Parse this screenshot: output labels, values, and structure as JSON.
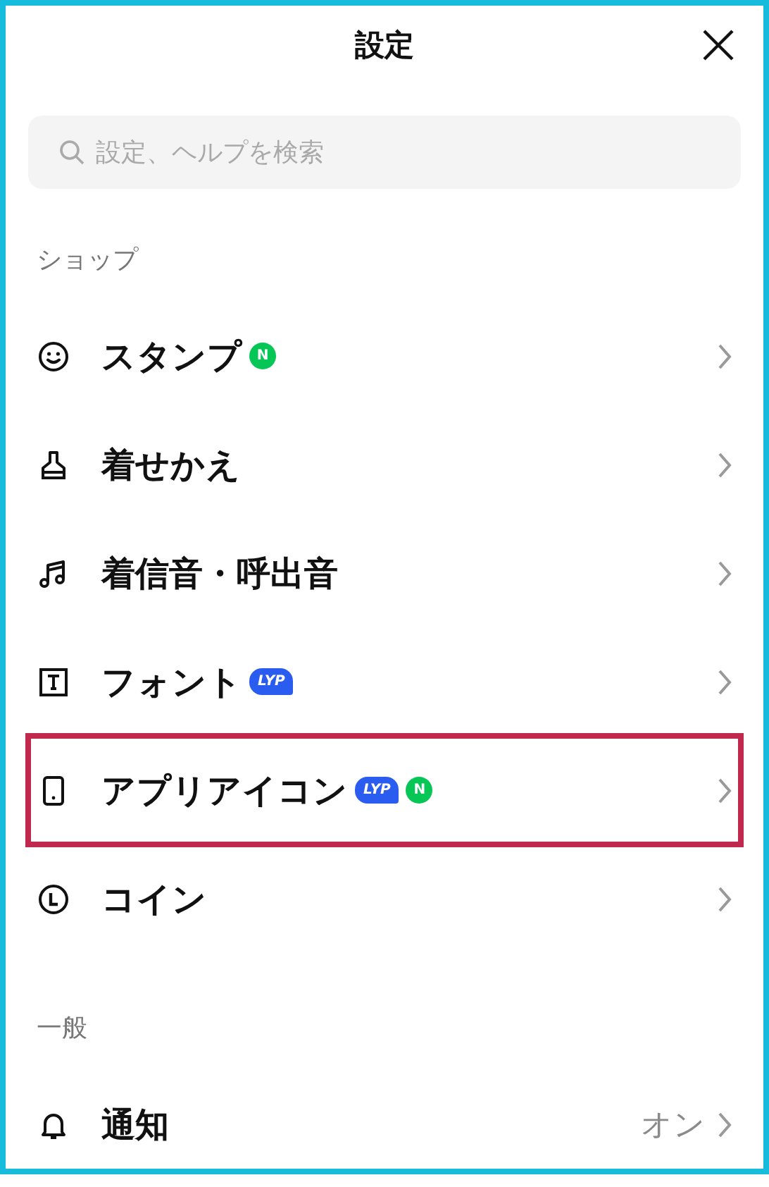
{
  "header": {
    "title": "設定"
  },
  "search": {
    "placeholder": "設定、ヘルプを検索"
  },
  "sections": [
    {
      "title": "ショップ",
      "items": [
        {
          "label": "スタンプ",
          "badges": [
            {
              "kind": "new",
              "text": "N"
            }
          ],
          "highlighted": false
        },
        {
          "label": "着せかえ",
          "highlighted": false
        },
        {
          "label": "着信音・呼出音",
          "highlighted": false
        },
        {
          "label": "フォント",
          "badges": [
            {
              "kind": "lyp",
              "text": "LYP"
            }
          ],
          "highlighted": false
        },
        {
          "label": "アプリアイコン",
          "badges": [
            {
              "kind": "lyp",
              "text": "LYP"
            },
            {
              "kind": "new",
              "text": "N"
            }
          ],
          "highlighted": true
        },
        {
          "label": "コイン",
          "highlighted": false
        }
      ]
    },
    {
      "title": "一般",
      "items": [
        {
          "label": "通知",
          "value": "オン",
          "highlighted": false
        }
      ]
    }
  ]
}
